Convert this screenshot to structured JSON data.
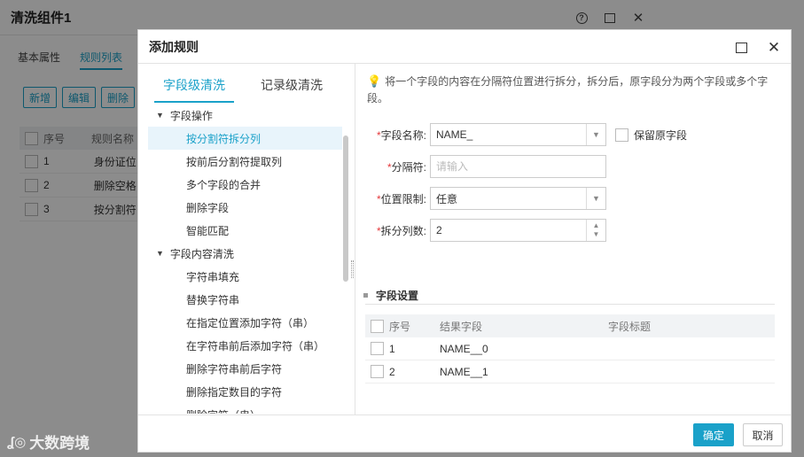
{
  "bg_window": {
    "title": "清洗组件1",
    "ctrl_help": "?",
    "tabs": [
      "基本属性",
      "规则列表"
    ],
    "buttons": [
      "新增",
      "编辑",
      "删除"
    ],
    "table_headers": [
      "序号",
      "规则名称"
    ],
    "rows": [
      {
        "no": "1",
        "name": "身份证位"
      },
      {
        "no": "2",
        "name": "删除空格"
      },
      {
        "no": "3",
        "name": "按分割符"
      }
    ]
  },
  "watermark": "大数跨境",
  "dialog": {
    "title": "添加规则",
    "tabs": [
      "字段级清洗",
      "记录级清洗"
    ],
    "tree": {
      "groups": [
        {
          "label": "字段操作",
          "items": [
            "按分割符拆分列",
            "按前后分割符提取列",
            "多个字段的合并",
            "删除字段",
            "智能匹配"
          ]
        },
        {
          "label": "字段内容清洗",
          "items": [
            "字符串填充",
            "替换字符串",
            "在指定位置添加字符（串）",
            "在字符串前后添加字符（串）",
            "删除字符串前后字符",
            "删除指定数目的字符",
            "删除字符（串）"
          ]
        }
      ],
      "selected": "按分割符拆分列"
    },
    "hint": "将一个字段的内容在分隔符位置进行拆分，拆分后，原字段分为两个字段或多个字段。",
    "form": {
      "field_name_label": "字段名称:",
      "field_name_value": "NAME_",
      "keep_original_label": "保留原字段",
      "separator_label": "分隔符:",
      "separator_placeholder": "请输入",
      "position_label": "位置限制:",
      "position_value": "任意",
      "split_count_label": "拆分列数:",
      "split_count_value": "2"
    },
    "field_settings": {
      "title": "字段设置",
      "headers": [
        "序号",
        "结果字段",
        "字段标题"
      ],
      "rows": [
        {
          "no": "1",
          "result": "NAME__0",
          "title": ""
        },
        {
          "no": "2",
          "result": "NAME__1",
          "title": ""
        }
      ]
    },
    "ok_label": "确定",
    "cancel_label": "取消"
  },
  "colors": {
    "accent": "#1aa1c9",
    "required": "#e5383b"
  }
}
